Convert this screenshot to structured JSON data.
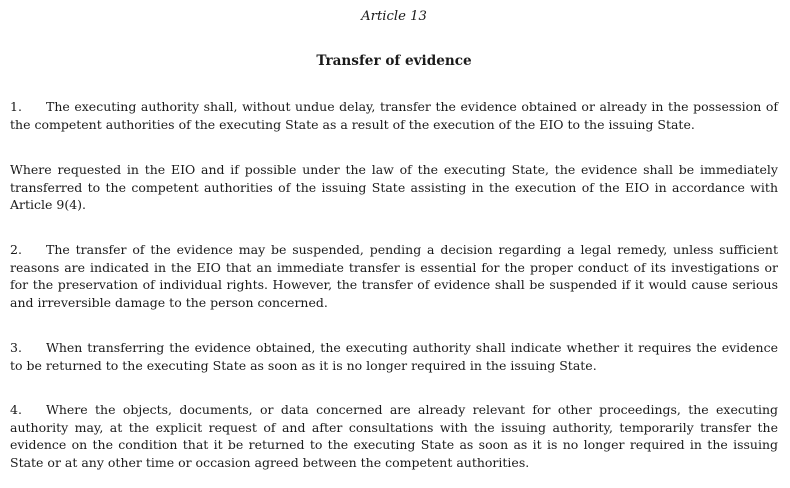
{
  "article": {
    "number": "Article 13",
    "title": "Transfer of evidence"
  },
  "paragraphs": [
    {
      "num": "1.",
      "text": "The executing authority shall, without undue delay, transfer the evidence obtained or already in the possession of the competent authorities of the executing State as a result of the execution of the EIO to the issuing State."
    },
    {
      "num": "",
      "text": "Where requested in the EIO and if possible under the law of the executing State, the evidence shall be immediately trans­ferred to the competent authorities of the issuing State assisting in the execution of the EIO in accordance with Article 9(4)."
    },
    {
      "num": "2.",
      "text": "The transfer of the evidence may be suspended, pending a decision regarding a legal remedy, unless sufficient reasons are indicated in the EIO that an immediate transfer is essential for the proper conduct of its investigations or for the preservation of individual rights. However, the transfer of evidence shall be suspended if it would cause serious and irreversible damage to the person concerned."
    },
    {
      "num": "3.",
      "text": "When transferring the evidence obtained, the executing authority shall indicate whether it requires the evidence to be returned to the executing State as soon as it is no longer required in the issuing State."
    },
    {
      "num": "4.",
      "text": "Where the objects, documents, or data concerned are already relevant for other proceedings, the executing authority may, at the explicit request of and after consultations with the issuing authority, temporarily transfer the evidence on the condition that it be returned to the executing State as soon as it is no longer required in the issuing State or at any other time or occasion agreed between the competent authorities."
    }
  ]
}
